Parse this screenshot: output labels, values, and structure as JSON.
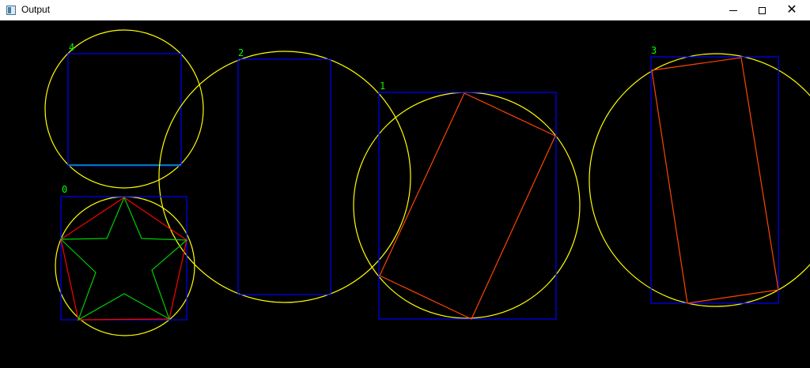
{
  "window": {
    "title": "Output"
  },
  "controls": {
    "minimize_icon": "minimize-icon",
    "maximize_icon": "maximize-icon",
    "close_icon": "close-icon"
  },
  "colors": {
    "background": "#000000",
    "circle": "#ffff00",
    "box": "#0000ff",
    "rotated_rect": "#ff4500",
    "polygon": "#ff0000",
    "contour": "#00ff00",
    "label": "#00ff00"
  },
  "shapes": [
    {
      "id": "4",
      "label": "4"
    },
    {
      "id": "2",
      "label": "2"
    },
    {
      "id": "1",
      "label": "1"
    },
    {
      "id": "3",
      "label": "3"
    },
    {
      "id": "0",
      "label": "0"
    }
  ]
}
